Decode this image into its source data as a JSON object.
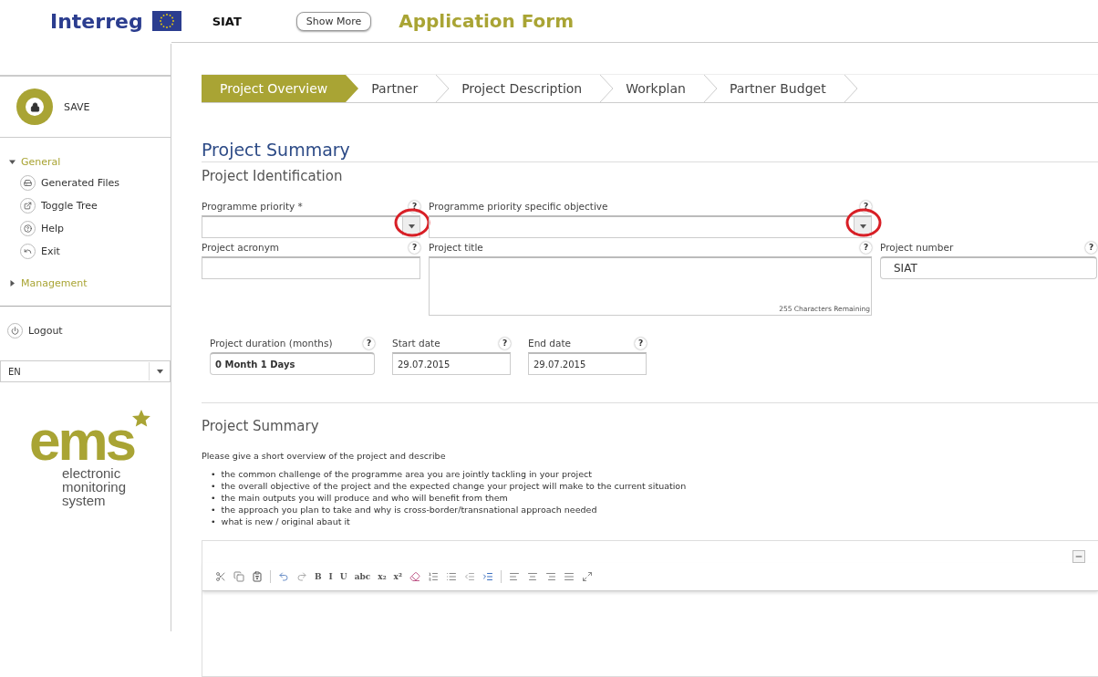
{
  "header": {
    "brand": "Interreg",
    "project": "SIAT",
    "show_more": "Show More",
    "title": "Application Form"
  },
  "sidebar": {
    "save": "SAVE",
    "sections": [
      {
        "label": "General",
        "expanded": true,
        "items": [
          {
            "label": "Generated Files"
          },
          {
            "label": "Toggle Tree"
          },
          {
            "label": "Help"
          },
          {
            "label": "Exit"
          }
        ]
      },
      {
        "label": "Management",
        "expanded": false
      }
    ],
    "logout": "Logout",
    "language": "EN",
    "logo": {
      "mark": "ems",
      "lines": [
        "electronic",
        "monitoring",
        "system"
      ]
    }
  },
  "steps": [
    {
      "label": "Project Overview",
      "selected": true
    },
    {
      "label": "Partner",
      "selected": false
    },
    {
      "label": "Project Description",
      "selected": false
    },
    {
      "label": "Workplan",
      "selected": false
    },
    {
      "label": "Partner Budget",
      "selected": false
    }
  ],
  "page_title": "Project Summary",
  "identification": {
    "title": "Project Identification",
    "help": "?",
    "priority": {
      "label": "Programme priority *"
    },
    "objective": {
      "label": "Programme priority specific objective"
    },
    "acronym": {
      "label": "Project acronym"
    },
    "project_title": {
      "label": "Project title",
      "counter": "255 Characters Remaining"
    },
    "number": {
      "label": "Project number",
      "value": "SIAT"
    },
    "duration": {
      "label": "Project duration (months)",
      "value": "0 Month 1 Days"
    },
    "start": {
      "label": "Start date",
      "value": "29.07.2015"
    },
    "end": {
      "label": "End date",
      "value": "29.07.2015"
    }
  },
  "summary": {
    "title": "Project Summary",
    "intro": "Please give a short overview of the project and describe",
    "marker": "•",
    "bullets": [
      "the common challenge of the programme area you are jointly tackling in your project",
      "the overall objective of the project and the expected change your project will make to the current situation",
      "the main outputs you will produce and who will benefit from them",
      "the approach you plan to take and why is cross-border/transnational approach needed",
      "what is new / original abaut it"
    ],
    "toolbar_text": [
      "B",
      "I",
      "U",
      "abc",
      "x₂",
      "x²"
    ]
  }
}
